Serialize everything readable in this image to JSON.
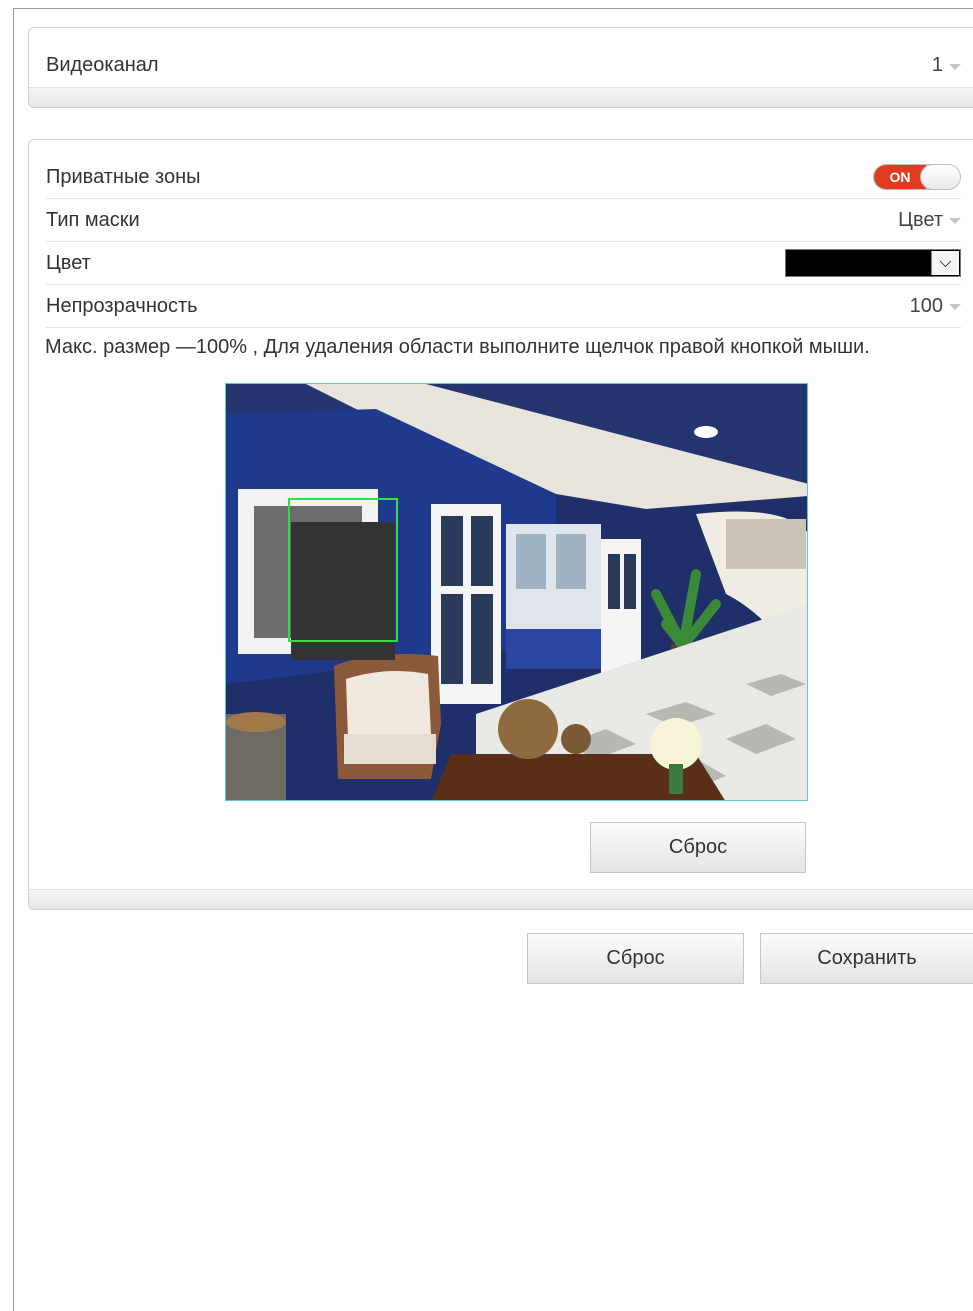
{
  "channel": {
    "label": "Видеоканал",
    "value": "1"
  },
  "privacy": {
    "zones_label": "Приватные зоны",
    "toggle_state": "ON",
    "mask_type_label": "Тип маски",
    "mask_type_value": "Цвет",
    "color_label": "Цвет",
    "color_value": "#000000",
    "opacity_label": "Непрозрачность",
    "opacity_value": "100",
    "hint": "Макс. размер —100% , Для удаления области выполните щелчок правой кнопкой мыши.",
    "reset_label": "Сброс"
  },
  "actions": {
    "reset_label": "Сброс",
    "save_label": "Сохранить"
  },
  "colors": {
    "toggle_on": "#e03c1f",
    "zone_border": "#2fdc4a",
    "mask_fill": "#333333"
  }
}
